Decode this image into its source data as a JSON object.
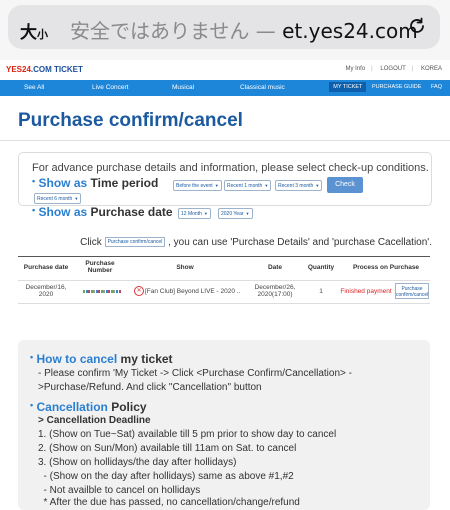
{
  "browser": {
    "aa_label": "大",
    "aa_small": "小",
    "url_warning": "安全ではありません — ",
    "url_host": "et.yes24.com"
  },
  "site": {
    "logo_brand": "YES24",
    "logo_suffix": ".COM TICKET",
    "top_links": [
      "My Info",
      "LOGOUT",
      "KOREA"
    ],
    "nav": [
      "See All",
      "Live Concert",
      "Musical",
      "Classical music"
    ],
    "nav_right": [
      "MY TICKET",
      "PURCHASE GUIDE",
      "FAQ"
    ]
  },
  "page": {
    "title": "Purchase confirm/cancel"
  },
  "filter": {
    "intro": "For advance purchase details and information, please select check-up conditions.",
    "show_as": "Show as",
    "time_period_label": "Time period",
    "time_options": [
      "Before the event",
      "Recent 1 month",
      "Recent 3 month",
      "Recent 6 month"
    ],
    "check_label": "Check",
    "purchase_date_label": "Purchase date",
    "month_value": "12 Month",
    "year_value": "2020 Year"
  },
  "click_line": {
    "prefix": "Click",
    "button": "Purchase confirm/cancel",
    "suffix": ", you can use 'Purchase Details' and 'purchase Cacellation'."
  },
  "table": {
    "headers": [
      "Purchase date",
      "Purchase Number",
      "Show",
      "Date",
      "Quantity",
      "Process on Purchase"
    ],
    "row": {
      "purchase_date": "December/16, 2020",
      "show": "[Fan Club] Beyond LIVE - 2020 ..",
      "date": "December/26, 2020(17:00)",
      "quantity": "1",
      "process": "Finished payment",
      "button": "Purchase confirm/cancel"
    }
  },
  "info": {
    "how_to_blue": "How to cancel",
    "how_to_rest": " my ticket",
    "how_to_line1": "- Please confirm 'My Ticket -> Click <Purchase Confirm/Cancellation> -",
    "how_to_line2": ">Purchase/Refund. And click \"Cancellation\" button",
    "policy_blue": "Cancellation",
    "policy_rest": " Policy",
    "deadline": "> Cancellation Deadline",
    "lines": [
      "1. (Show on Tue~Sat) available till 5 pm prior to show day to cancel",
      "2. (Show on Sun/Mon) available till 11am on Sat. to cancel",
      "3. (Show on hollidays/the day after hollidays)",
      "  - (Show on the day after hollidays) same as above #1,#2",
      "  - Not availble to cancel on hollidays",
      "  * After the due has passed, no cancellation/change/refund"
    ]
  }
}
